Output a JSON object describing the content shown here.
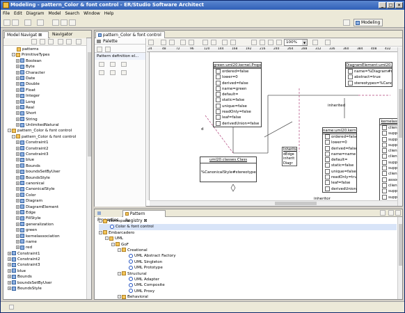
{
  "window": {
    "title": "Modeling - pattern_Color & font control - ER/Studio Software Architect"
  },
  "menu": [
    "File",
    "Edit",
    "Diagram",
    "Model",
    "Search",
    "Window",
    "Help"
  ],
  "perspective": "Modeling",
  "model_nav": {
    "tabs": [
      "Model Navigat",
      "Navigator"
    ],
    "rows": [
      {
        "t": "patterns",
        "d": 2,
        "i": "fold"
      },
      {
        "t": "PrimitiveTypes",
        "d": 2,
        "i": "fold",
        "e": "-"
      },
      {
        "t": "Boolean",
        "d": 3,
        "i": "cls",
        "e": "+"
      },
      {
        "t": "Byte",
        "d": 3,
        "i": "cls",
        "e": "+"
      },
      {
        "t": "Character",
        "d": 3,
        "i": "cls",
        "e": "+"
      },
      {
        "t": "Date",
        "d": 3,
        "i": "cls",
        "e": "+"
      },
      {
        "t": "Double",
        "d": 3,
        "i": "cls",
        "e": "+"
      },
      {
        "t": "Float",
        "d": 3,
        "i": "cls",
        "e": "+"
      },
      {
        "t": "Integer",
        "d": 3,
        "i": "cls",
        "e": "+"
      },
      {
        "t": "Long",
        "d": 3,
        "i": "cls",
        "e": "+"
      },
      {
        "t": "Real",
        "d": 3,
        "i": "cls",
        "e": "+"
      },
      {
        "t": "Short",
        "d": 3,
        "i": "cls",
        "e": "+"
      },
      {
        "t": "String",
        "d": 3,
        "i": "cls",
        "e": "+"
      },
      {
        "t": "UnlimitedNatural",
        "d": 3,
        "i": "cls",
        "e": "+"
      },
      {
        "t": "pattern_Color & font control",
        "d": 1,
        "i": "fold",
        "e": "-"
      },
      {
        "t": "pattern_Color & font control",
        "d": 2,
        "i": "fold",
        "e": "-"
      },
      {
        "t": "Constraint1",
        "d": 3,
        "i": "cls",
        "e": "+"
      },
      {
        "t": "Constraint2",
        "d": 3,
        "i": "cls",
        "e": "+"
      },
      {
        "t": "Constraint3",
        "d": 3,
        "i": "cls",
        "e": "+"
      },
      {
        "t": "blue",
        "d": 3,
        "i": "cls",
        "e": "+"
      },
      {
        "t": "Bounds",
        "d": 3,
        "i": "cls",
        "e": "+"
      },
      {
        "t": "boundsSetByUser",
        "d": 3,
        "i": "cls",
        "e": "+"
      },
      {
        "t": "BoundsStyle",
        "d": 3,
        "i": "cls",
        "e": "+"
      },
      {
        "t": "canonical",
        "d": 3,
        "i": "cls",
        "e": "+"
      },
      {
        "t": "CanonicalStyle",
        "d": 3,
        "i": "cls",
        "e": "+"
      },
      {
        "t": "Color",
        "d": 3,
        "i": "cls",
        "e": "+"
      },
      {
        "t": "Diagram",
        "d": 3,
        "i": "cls",
        "e": "+"
      },
      {
        "t": "DiagramElement",
        "d": 3,
        "i": "cls",
        "e": "+"
      },
      {
        "t": "Edge",
        "d": 3,
        "i": "cls",
        "e": "+"
      },
      {
        "t": "FillStyle",
        "d": 3,
        "i": "cls",
        "e": "+"
      },
      {
        "t": "generalization",
        "d": 3,
        "i": "cls",
        "e": "+"
      },
      {
        "t": "green",
        "d": 3,
        "i": "cls",
        "e": "+"
      },
      {
        "t": "kernelassociation",
        "d": 3,
        "i": "cls",
        "e": "+"
      },
      {
        "t": "name",
        "d": 3,
        "i": "cls",
        "e": "+"
      },
      {
        "t": "red",
        "d": 3,
        "i": "cls",
        "e": "+"
      },
      {
        "t": "Constraint1",
        "d": 1,
        "i": "cls",
        "e": "+"
      },
      {
        "t": "Constraint2",
        "d": 1,
        "i": "cls",
        "e": "+"
      },
      {
        "t": "Constraint3",
        "d": 1,
        "i": "cls",
        "e": "+"
      },
      {
        "t": "blue",
        "d": 1,
        "i": "cls",
        "e": "+"
      },
      {
        "t": "Bounds",
        "d": 1,
        "i": "cls",
        "e": "+"
      },
      {
        "t": "boundsSetByUser",
        "d": 1,
        "i": "cls",
        "e": "+"
      },
      {
        "t": "BoundsStyle",
        "d": 1,
        "i": "cls",
        "e": "+"
      }
    ]
  },
  "editor": {
    "tab": "pattern_Color & font control",
    "palette_title": "Palette",
    "palette_section": "Pattern definition el...",
    "zoom": "100%",
    "ruler": [
      "24",
      "48",
      "72",
      "96",
      "120",
      "144",
      "168",
      "192",
      "216",
      "240",
      "264",
      "288",
      "312",
      "336",
      "360",
      "384",
      "408",
      "432"
    ]
  },
  "classes": {
    "green": {
      "header": "green:uml20.kernel.Property",
      "attrs": [
        "ordered=false",
        "lower=0",
        "derived=false",
        "name=green",
        "default=",
        "static=false",
        "unique=false",
        "readOnly=false",
        "leaf=false",
        "derivedUnion=false"
      ]
    },
    "diagElem": {
      "header": "DiagramElement:uml20.classes.Class",
      "attrs": [
        "name=%Diagram#name%Element",
        "abstract=true",
        "stereotypes=%CanonicalStyle#stereotypes%"
      ]
    },
    "name": {
      "header": "name:uml20.kernel.Property",
      "attrs": [
        "ordered=false",
        "lower=0",
        "derived=false",
        "name=name",
        "default=",
        "static=false",
        "unique=false",
        "readOnly=true",
        "leaf=false",
        "derivedUnion=false"
      ]
    },
    "kernel": {
      "header": "kernelassociation:uml20.kernel.Ass",
      "attrs": [
        "clientReadOnly=false",
        "supplierReadOnly=false",
        "supplierUnique=true",
        "supplierCardinality=0..*",
        "clientDerivedUnion=false",
        "clientNavigability=NOT_NAVIGABLE",
        "supplierRole=edges",
        "supplierDerived=false",
        "clientDerived=false",
        "associatesType=aggregation",
        "clientOrdered=false",
        "supplierOrdered=true",
        "supplierDerivedUnion=false",
        "leaf=false",
        "derived=false",
        "clientUnique=true"
      ]
    },
    "uml": {
      "header": "uml20.classes.Class",
      "attrs": []
    },
    "stereo": "%CanonicalStyle#stereotypes%"
  },
  "connectors": {
    "inherited": "inherited",
    "inheritor": "inheritor",
    "note": [
      "Inherits",
      "dEdge",
      "inherit",
      "Diagr"
    ],
    "d": "d"
  },
  "bottom": {
    "tabs": [
      "Properties",
      "Pattern Registry"
    ],
    "rows": [
      {
        "t": "Workspace",
        "d": 0,
        "i": "fold",
        "e": "-"
      },
      {
        "t": "Color & font control",
        "d": 1,
        "i": "circ",
        "sel": true
      },
      {
        "t": "Embarcadero",
        "d": 0,
        "i": "fold",
        "e": "-"
      },
      {
        "t": "UML",
        "d": 1,
        "i": "fold",
        "e": "-"
      },
      {
        "t": "GoF",
        "d": 2,
        "i": "fold",
        "e": "-"
      },
      {
        "t": "Creational",
        "d": 3,
        "i": "fold",
        "e": "-"
      },
      {
        "t": "UML Abstract Factory",
        "d": 4,
        "i": "circ"
      },
      {
        "t": "UML Singleton",
        "d": 4,
        "i": "circ"
      },
      {
        "t": "UML Prototype",
        "d": 4,
        "i": "circ"
      },
      {
        "t": "Structural",
        "d": 3,
        "i": "fold",
        "e": "-"
      },
      {
        "t": "UML Adapter",
        "d": 4,
        "i": "circ"
      },
      {
        "t": "UML Composite",
        "d": 4,
        "i": "circ"
      },
      {
        "t": "UML Proxy",
        "d": 4,
        "i": "circ"
      },
      {
        "t": "Behavioral",
        "d": 3,
        "i": "fold",
        "e": "-"
      }
    ]
  }
}
